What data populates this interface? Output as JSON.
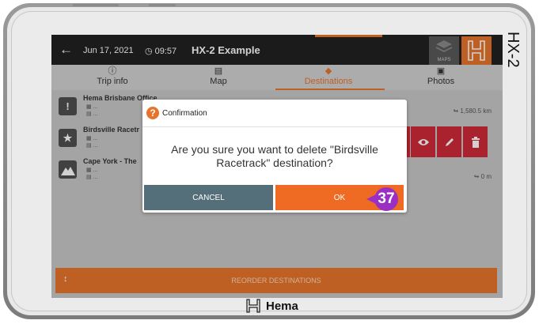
{
  "device": {
    "side_brand": "HX-2",
    "bottom_brand": "Hema"
  },
  "topbar": {
    "back_icon": "arrow-left-icon",
    "date": "Jun 17, 2021",
    "time": "09:57",
    "trip_name": "HX-2 Example",
    "maps_label": "MAPS"
  },
  "tabs": [
    {
      "label": "Trip info",
      "icon": "info-icon"
    },
    {
      "label": "Map",
      "icon": "map-icon"
    },
    {
      "label": "Destinations",
      "icon": "direction-icon",
      "active": true
    },
    {
      "label": "Photos",
      "icon": "camera-icon"
    }
  ],
  "destinations": [
    {
      "name": "Hema Brisbane Office",
      "distance_value": "1,580.5",
      "distance_unit": "km",
      "icon": "exclamation-icon"
    },
    {
      "name": "Birdsville Racetr",
      "icon": "star-shield-icon"
    },
    {
      "name": "Cape York - The",
      "distance_value": "0",
      "distance_unit": "m",
      "icon": "mountain-icon"
    }
  ],
  "reorder_label": "REORDER DESTINATIONS",
  "dialog": {
    "title": "Confirmation",
    "message": "Are you sure you want to delete \"Birdsville Racetrack\" destination?",
    "cancel_label": "CANCEL",
    "ok_label": "OK"
  },
  "callout_number": "37",
  "colors": {
    "accent": "#e8742c",
    "cancel": "#546e7a",
    "delete_red": "#cf2a38",
    "callout": "#9b2fc4"
  }
}
